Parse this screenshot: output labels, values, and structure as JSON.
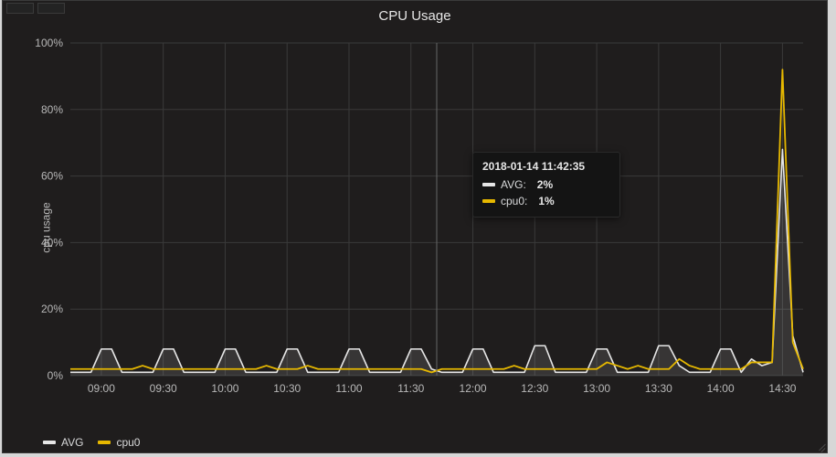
{
  "title": "CPU Usage",
  "ylabel": "cpu usage",
  "colors": {
    "avg": "#e6e6e6",
    "cpu0": "#e6b800"
  },
  "tooltip": {
    "timestamp": "2018-01-14 11:42:35",
    "rows": [
      {
        "name": "AVG:",
        "value": "2%",
        "color": "#e6e6e6"
      },
      {
        "name": "cpu0:",
        "value": "1%",
        "color": "#e6b800"
      }
    ]
  },
  "legend": [
    {
      "name": "AVG",
      "color": "#e6e6e6"
    },
    {
      "name": "cpu0",
      "color": "#e6b800"
    }
  ],
  "chart_data": {
    "type": "line",
    "title": "CPU Usage",
    "xlabel": "",
    "ylabel": "cpu usage",
    "ylim": [
      0,
      100
    ],
    "y_ticks": [
      "0%",
      "20%",
      "40%",
      "60%",
      "80%",
      "100%"
    ],
    "x_ticks": [
      "09:00",
      "09:30",
      "10:00",
      "10:30",
      "11:00",
      "11:30",
      "12:00",
      "12:30",
      "13:00",
      "13:30",
      "14:00",
      "14:30"
    ],
    "x": [
      "08:45",
      "08:50",
      "08:55",
      "09:00",
      "09:05",
      "09:10",
      "09:15",
      "09:20",
      "09:25",
      "09:30",
      "09:35",
      "09:40",
      "09:45",
      "09:50",
      "09:55",
      "10:00",
      "10:05",
      "10:10",
      "10:15",
      "10:20",
      "10:25",
      "10:30",
      "10:35",
      "10:40",
      "10:45",
      "10:50",
      "10:55",
      "11:00",
      "11:05",
      "11:10",
      "11:15",
      "11:20",
      "11:25",
      "11:30",
      "11:35",
      "11:40",
      "11:45",
      "11:50",
      "11:55",
      "12:00",
      "12:05",
      "12:10",
      "12:15",
      "12:20",
      "12:25",
      "12:30",
      "12:35",
      "12:40",
      "12:45",
      "12:50",
      "12:55",
      "13:00",
      "13:05",
      "13:10",
      "13:15",
      "13:20",
      "13:25",
      "13:30",
      "13:35",
      "13:40",
      "13:45",
      "13:50",
      "13:55",
      "14:00",
      "14:05",
      "14:10",
      "14:15",
      "14:20",
      "14:25",
      "14:30",
      "14:35",
      "14:40"
    ],
    "series": [
      {
        "name": "AVG",
        "color": "#e6e6e6",
        "values": [
          1,
          1,
          1,
          8,
          8,
          1,
          1,
          1,
          1,
          8,
          8,
          1,
          1,
          1,
          1,
          8,
          8,
          1,
          1,
          1,
          1,
          8,
          8,
          1,
          1,
          1,
          1,
          8,
          8,
          1,
          1,
          1,
          1,
          8,
          8,
          2,
          1,
          1,
          1,
          8,
          8,
          1,
          1,
          1,
          1,
          9,
          9,
          1,
          1,
          1,
          1,
          8,
          8,
          1,
          1,
          1,
          1,
          9,
          9,
          3,
          1,
          1,
          1,
          8,
          8,
          1,
          5,
          3,
          4,
          68,
          12,
          1
        ]
      },
      {
        "name": "cpu0",
        "color": "#e6b800",
        "values": [
          2,
          2,
          2,
          2,
          2,
          2,
          2,
          3,
          2,
          2,
          2,
          2,
          2,
          2,
          2,
          2,
          2,
          2,
          2,
          3,
          2,
          2,
          2,
          3,
          2,
          2,
          2,
          2,
          2,
          2,
          2,
          2,
          2,
          2,
          2,
          1,
          2,
          2,
          2,
          2,
          2,
          2,
          2,
          3,
          2,
          2,
          2,
          2,
          2,
          2,
          2,
          2,
          4,
          3,
          2,
          3,
          2,
          2,
          2,
          5,
          3,
          2,
          2,
          2,
          2,
          2,
          4,
          4,
          4,
          92,
          10,
          2
        ]
      }
    ],
    "tooltip_sample": {
      "x": "11:42:35",
      "AVG": 2,
      "cpu0": 1
    }
  }
}
